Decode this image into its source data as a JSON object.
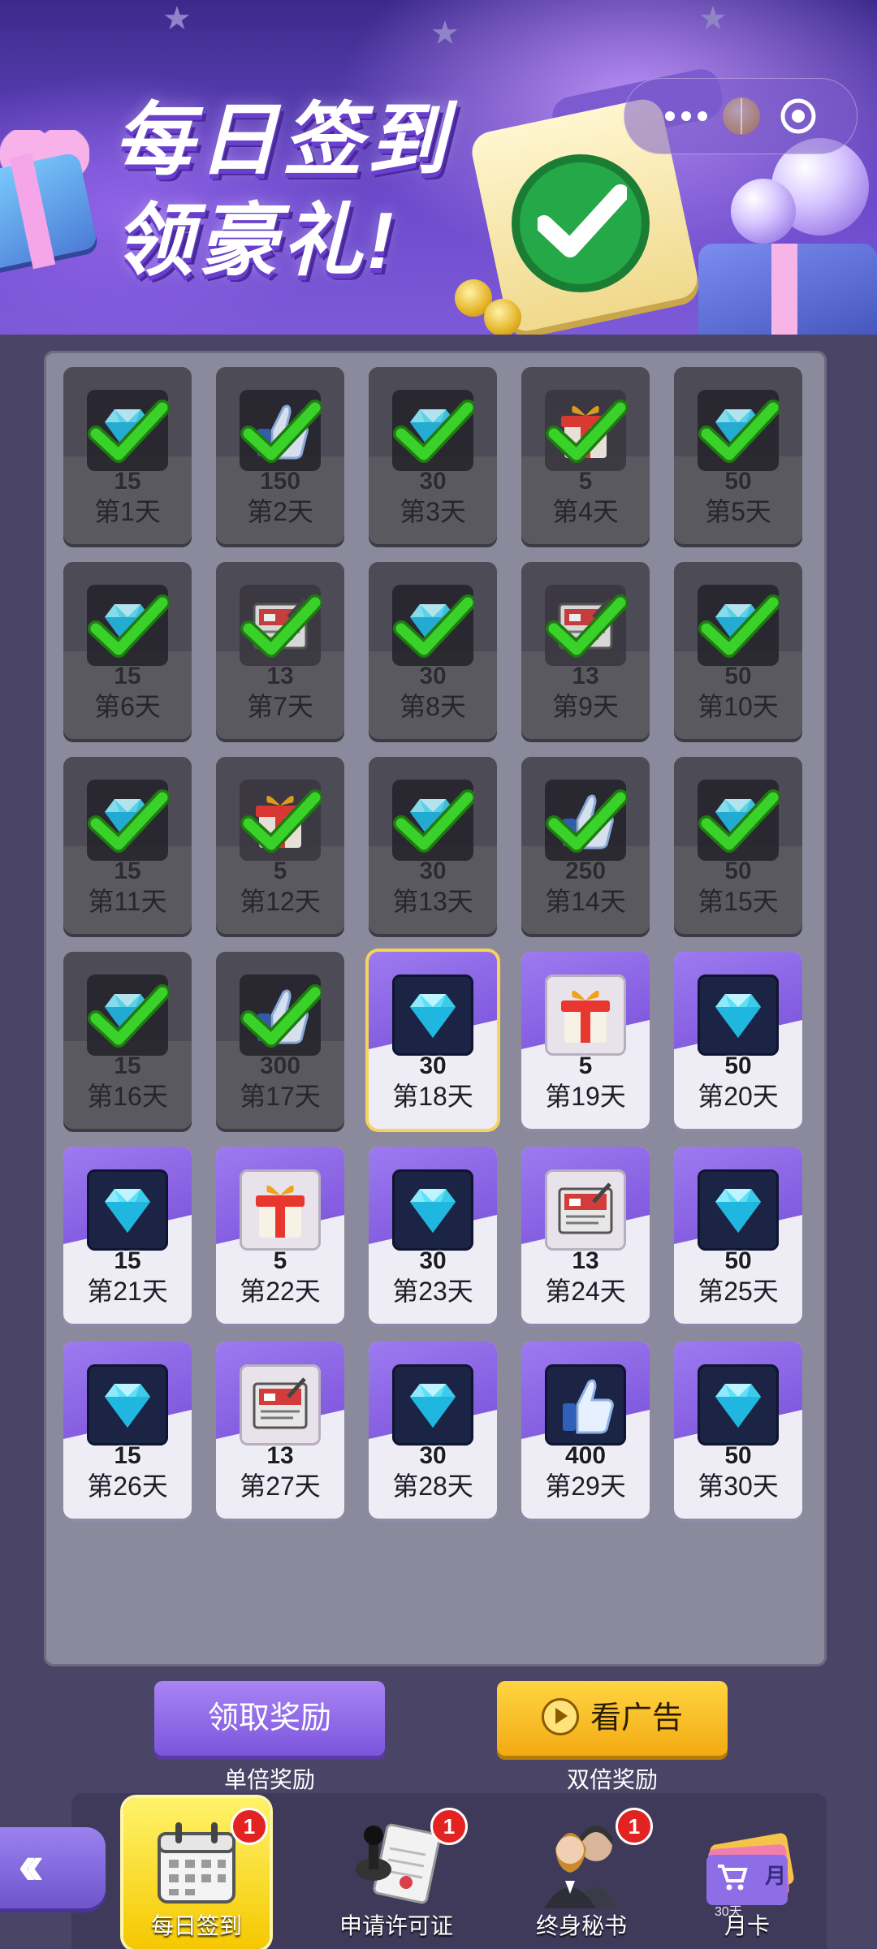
{
  "banner": {
    "line1": "每日签到",
    "line2": "领豪礼!"
  },
  "rewards": [
    {
      "day": "第1天",
      "qty": "15",
      "type": "diamond",
      "claimed": true
    },
    {
      "day": "第2天",
      "qty": "150",
      "type": "thumb",
      "claimed": true
    },
    {
      "day": "第3天",
      "qty": "30",
      "type": "diamond",
      "claimed": true
    },
    {
      "day": "第4天",
      "qty": "5",
      "type": "gift",
      "claimed": true
    },
    {
      "day": "第5天",
      "qty": "50",
      "type": "diamond",
      "claimed": true
    },
    {
      "day": "第6天",
      "qty": "15",
      "type": "diamond",
      "claimed": true
    },
    {
      "day": "第7天",
      "qty": "13",
      "type": "license",
      "claimed": true
    },
    {
      "day": "第8天",
      "qty": "30",
      "type": "diamond",
      "claimed": true
    },
    {
      "day": "第9天",
      "qty": "13",
      "type": "license",
      "claimed": true
    },
    {
      "day": "第10天",
      "qty": "50",
      "type": "diamond",
      "claimed": true
    },
    {
      "day": "第11天",
      "qty": "15",
      "type": "diamond",
      "claimed": true
    },
    {
      "day": "第12天",
      "qty": "5",
      "type": "gift",
      "claimed": true
    },
    {
      "day": "第13天",
      "qty": "30",
      "type": "diamond",
      "claimed": true
    },
    {
      "day": "第14天",
      "qty": "250",
      "type": "thumb",
      "claimed": true
    },
    {
      "day": "第15天",
      "qty": "50",
      "type": "diamond",
      "claimed": true
    },
    {
      "day": "第16天",
      "qty": "15",
      "type": "diamond",
      "claimed": true
    },
    {
      "day": "第17天",
      "qty": "300",
      "type": "thumb",
      "claimed": true
    },
    {
      "day": "第18天",
      "qty": "30",
      "type": "diamond",
      "claimed": false,
      "current": true
    },
    {
      "day": "第19天",
      "qty": "5",
      "type": "gift",
      "claimed": false
    },
    {
      "day": "第20天",
      "qty": "50",
      "type": "diamond",
      "claimed": false
    },
    {
      "day": "第21天",
      "qty": "15",
      "type": "diamond",
      "claimed": false
    },
    {
      "day": "第22天",
      "qty": "5",
      "type": "gift",
      "claimed": false
    },
    {
      "day": "第23天",
      "qty": "30",
      "type": "diamond",
      "claimed": false
    },
    {
      "day": "第24天",
      "qty": "13",
      "type": "license",
      "claimed": false
    },
    {
      "day": "第25天",
      "qty": "50",
      "type": "diamond",
      "claimed": false
    },
    {
      "day": "第26天",
      "qty": "15",
      "type": "diamond",
      "claimed": false
    },
    {
      "day": "第27天",
      "qty": "13",
      "type": "license",
      "claimed": false
    },
    {
      "day": "第28天",
      "qty": "30",
      "type": "diamond",
      "claimed": false
    },
    {
      "day": "第29天",
      "qty": "400",
      "type": "thumb",
      "claimed": false
    },
    {
      "day": "第30天",
      "qty": "50",
      "type": "diamond",
      "claimed": false
    }
  ],
  "actions": {
    "claim_label": "领取奖励",
    "claim_sub": "单倍奖励",
    "ad_label": "看广告",
    "ad_sub": "双倍奖励"
  },
  "nav": [
    {
      "label": "每日签到",
      "badge": "1",
      "icon": "calendar-icon",
      "active": true
    },
    {
      "label": "申请许可证",
      "badge": "1",
      "icon": "stamp-icon",
      "active": false
    },
    {
      "label": "终身秘书",
      "badge": "1",
      "icon": "secretary-icon",
      "active": false
    },
    {
      "label": "月卡",
      "badge": "",
      "icon": "month-card-icon",
      "active": false
    }
  ],
  "month_card": {
    "tag": "月",
    "sub": "30天"
  },
  "colors": {
    "accent": "#7c55dc",
    "gold": "#f3aa12",
    "check": "#3ad12a",
    "badge": "#e32222"
  }
}
